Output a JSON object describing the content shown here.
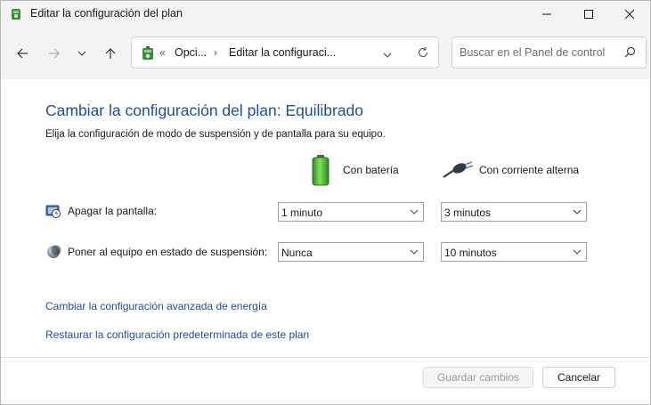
{
  "window": {
    "title": "Editar la configuración del plan"
  },
  "navigation": {
    "breadcrumb_overflow": "«",
    "breadcrumb": [
      {
        "label": "Opci..."
      },
      {
        "label": "Editar la configuraci..."
      }
    ],
    "breadcrumb_separator": "›",
    "search_placeholder": "Buscar en el Panel de control"
  },
  "main": {
    "heading": "Cambiar la configuración del plan: Equilibrado",
    "subtitle": "Elija la configuración de modo de suspensión y de pantalla para su equipo.",
    "columns": {
      "battery": "Con batería",
      "ac": "Con corriente alterna"
    },
    "settings": [
      {
        "label": "Apagar la pantalla:",
        "battery_value": "1 minuto",
        "ac_value": "3 minutos"
      },
      {
        "label": "Poner al equipo en estado de suspensión:",
        "battery_value": "Nunca",
        "ac_value": "10 minutos"
      }
    ],
    "links": {
      "advanced": "Cambiar la configuración avanzada de energía",
      "restore": "Restaurar la configuración predeterminada de este plan"
    }
  },
  "footer": {
    "save_label": "Guardar cambios",
    "cancel_label": "Cancelar"
  },
  "colors": {
    "link": "#1f4e99",
    "battery_green": "#3fae2a"
  },
  "icons": [
    "power-options-icon",
    "minimize-icon",
    "maximize-icon",
    "close-icon",
    "back-arrow-icon",
    "forward-arrow-icon",
    "recent-chevron-icon",
    "up-arrow-icon",
    "chevron-down-icon",
    "refresh-icon",
    "search-icon",
    "battery-icon",
    "ac-plug-icon",
    "display-clock-icon",
    "sleep-moon-icon"
  ]
}
